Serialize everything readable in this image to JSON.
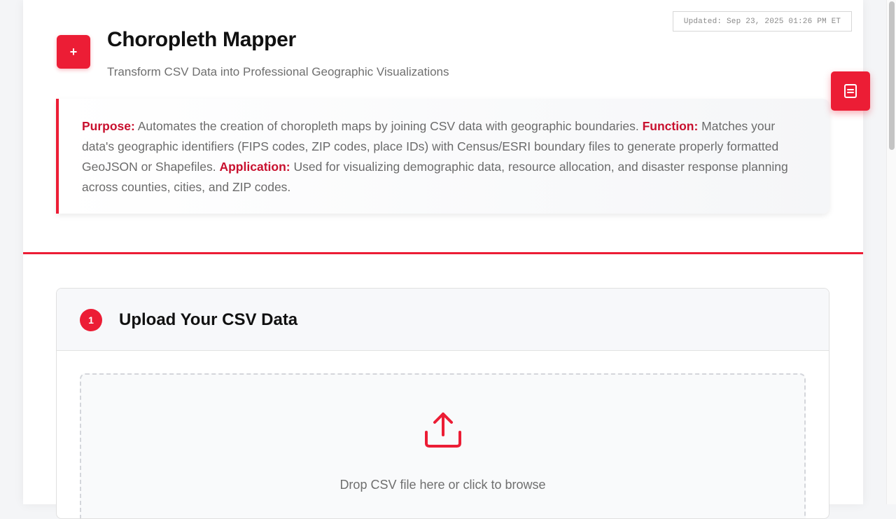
{
  "header": {
    "updated": "Updated: Sep 23, 2025 01:26 PM ET",
    "logo_glyph": "+",
    "title": "Choropleth Mapper",
    "subtitle": "Transform CSV Data into Professional Geographic Visualizations"
  },
  "intro": {
    "purpose_label": "Purpose:",
    "purpose_text": " Automates the creation of choropleth maps by joining CSV data with geographic boundaries. ",
    "function_label": "Function:",
    "function_text": " Matches your data's geographic identifiers (FIPS codes, ZIP codes, place IDs) with Census/ESRI boundary files to generate properly formatted GeoJSON or Shapefiles. ",
    "application_label": "Application:",
    "application_text": " Used for visualizing demographic data, resource allocation, and disaster response planning across counties, cities, and ZIP codes."
  },
  "step1": {
    "number": "1",
    "title": "Upload Your CSV Data",
    "drop_text": "Drop CSV file here or click to browse"
  },
  "icons": {
    "upload": "upload-icon",
    "float": "document-icon"
  },
  "colors": {
    "accent": "#ec1d35",
    "accent_dark": "#c8102e"
  }
}
